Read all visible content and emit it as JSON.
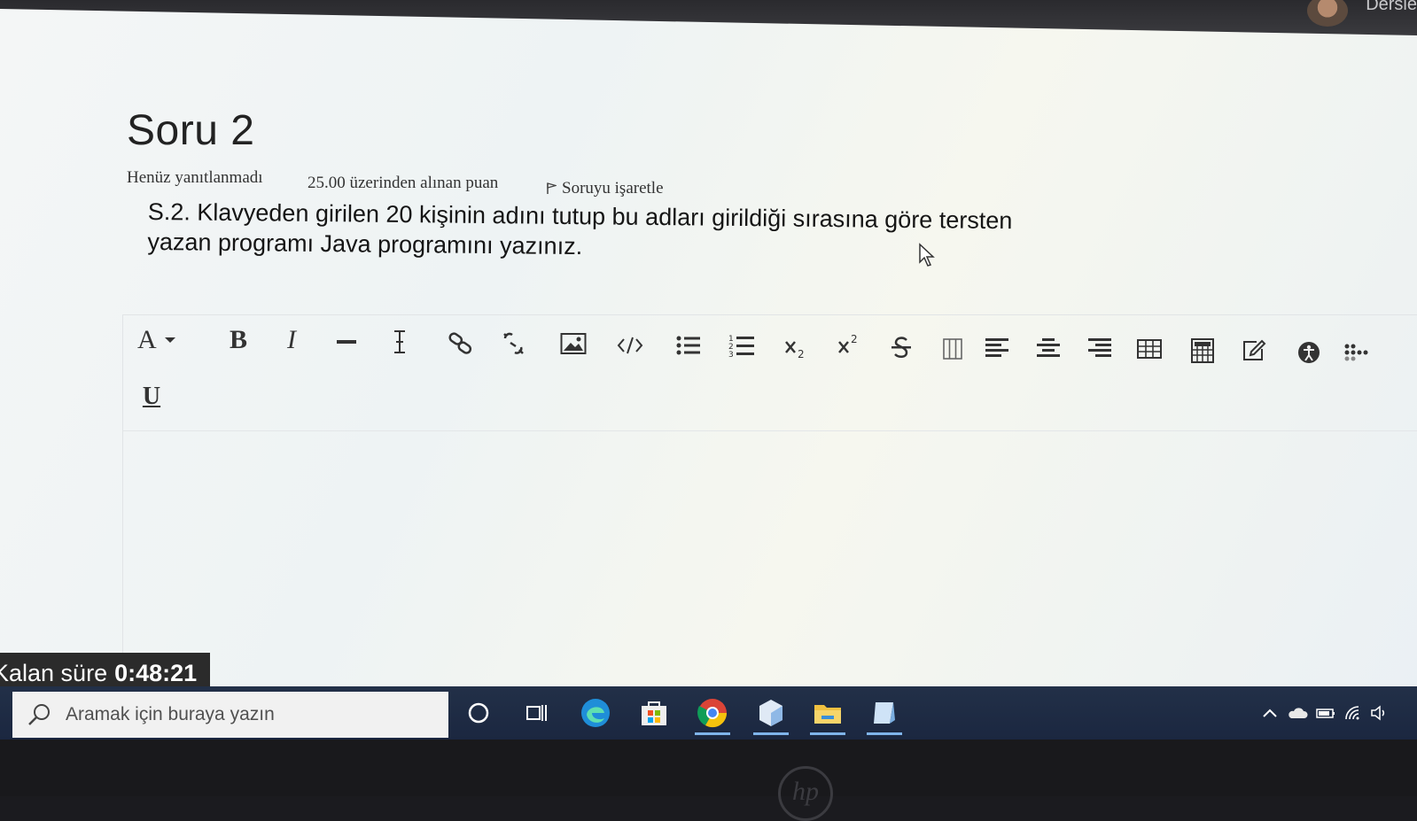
{
  "header": {
    "user_name": "Dersle"
  },
  "question": {
    "title": "Soru 2",
    "status": "Henüz yanıtlanmadı",
    "points": "25.00 üzerinden alınan puan",
    "flag_label": "Soruyu işaretle",
    "text": "S.2. Klavyeden girilen 20 kişinin adını tutup bu adları girildiği sırasına göre tersten yazan programı Java programını yazınız."
  },
  "editor": {
    "toolbar": [
      {
        "name": "font-family-button",
        "label": "A"
      },
      {
        "name": "bold-button",
        "label": "B"
      },
      {
        "name": "italic-button",
        "label": "I"
      },
      {
        "name": "horizontal-rule-button",
        "icon": "hr-icon"
      },
      {
        "name": "text-cursor-button",
        "icon": "text-cursor-icon"
      },
      {
        "name": "link-button",
        "icon": "link-icon"
      },
      {
        "name": "unlink-button",
        "icon": "unlink-icon"
      },
      {
        "name": "image-button",
        "icon": "image-icon"
      },
      {
        "name": "code-button",
        "icon": "code-icon"
      },
      {
        "name": "bullet-list-button",
        "icon": "bullet-list-icon"
      },
      {
        "name": "numbered-list-button",
        "icon": "numbered-list-icon"
      },
      {
        "name": "subscript-button",
        "icon": "subscript-icon"
      },
      {
        "name": "superscript-button",
        "icon": "superscript-icon"
      },
      {
        "name": "strikethrough-button",
        "icon": "strikethrough-icon"
      },
      {
        "name": "columns-button",
        "icon": "columns-icon"
      },
      {
        "name": "align-left-button",
        "icon": "align-left-icon"
      },
      {
        "name": "align-center-button",
        "icon": "align-center-icon"
      },
      {
        "name": "align-right-button",
        "icon": "align-right-icon"
      },
      {
        "name": "table-button",
        "icon": "table-icon"
      },
      {
        "name": "calculator-button",
        "icon": "calculator-icon"
      },
      {
        "name": "edit-button",
        "icon": "edit-icon"
      },
      {
        "name": "accessibility-button",
        "icon": "accessibility-icon"
      },
      {
        "name": "more-button",
        "icon": "more-icon"
      },
      {
        "name": "underline-button",
        "label": "U"
      }
    ],
    "labels": {
      "font": "A",
      "bold": "B",
      "italic": "I",
      "underline": "U"
    }
  },
  "timer": {
    "label": "Kalan süre",
    "value": "0:48:21"
  },
  "taskbar": {
    "search_placeholder": "Aramak için buraya yazın",
    "apps": [
      "cortana-icon",
      "task-view-icon",
      "edge-icon",
      "store-icon",
      "chrome-icon",
      "box-app-icon",
      "file-explorer-icon",
      "note-app-icon"
    ],
    "tray": [
      "chevron-up-icon",
      "onedrive-icon",
      "battery-icon",
      "wifi-icon",
      "volume-icon"
    ]
  },
  "brand": {
    "logo_text": "hp"
  },
  "colors": {
    "taskbar": "#1f2c44",
    "timer_bg": "#2b2b2b",
    "accent_underline": "#7fb4ea"
  }
}
